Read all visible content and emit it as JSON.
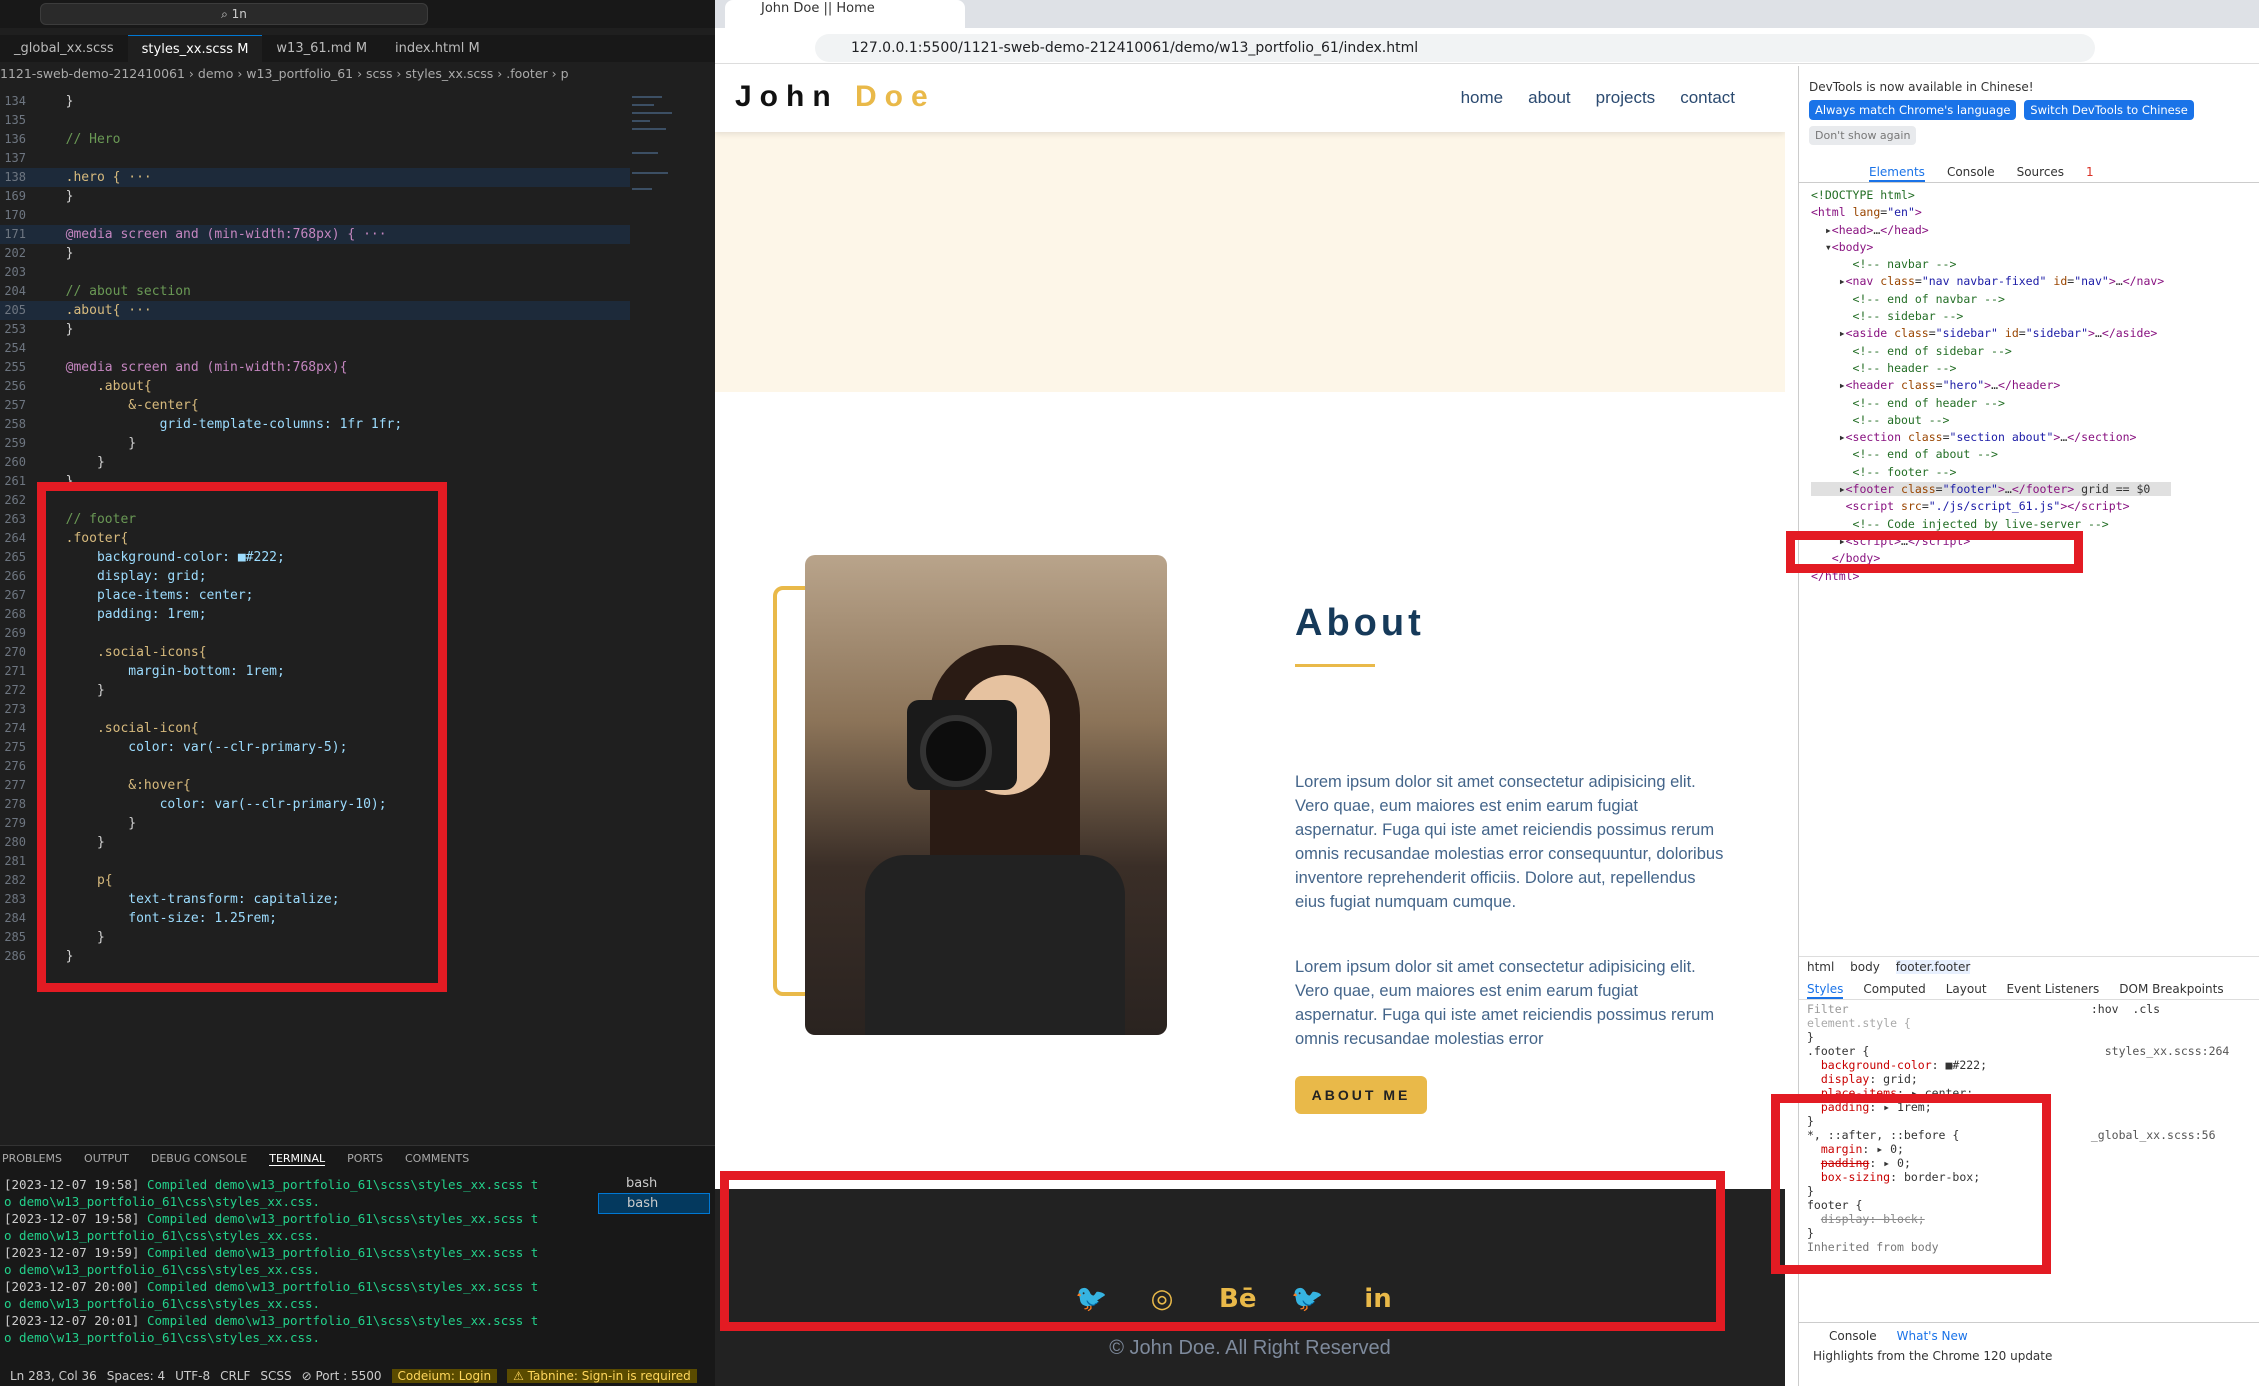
{
  "vscode": {
    "command_center": "⌕ 1n",
    "tabs": [
      "_global_xx.scss",
      "styles_xx.scss M",
      "w13_61.md M",
      "index.html M"
    ],
    "breadcrumb": "1121-sweb-demo-212410061 › demo › w13_portfolio_61 › scss › styles_xx.scss › .footer › p",
    "code_lines": [
      {
        "n": "134",
        "t": "  }",
        "c": "brace"
      },
      {
        "n": "135",
        "t": "",
        "c": "brace"
      },
      {
        "n": "136",
        "t": "  // Hero",
        "c": "com"
      },
      {
        "n": "137",
        "t": "",
        "c": "brace"
      },
      {
        "n": "138",
        "t": "  .hero { ···",
        "c": "sel",
        "hl": true
      },
      {
        "n": "169",
        "t": "  }",
        "c": "brace"
      },
      {
        "n": "170",
        "t": "",
        "c": "brace"
      },
      {
        "n": "171",
        "t": "  @media screen and (min-width:768px) { ···",
        "c": "key",
        "hl": true
      },
      {
        "n": "202",
        "t": "  }",
        "c": "brace"
      },
      {
        "n": "203",
        "t": "",
        "c": "brace"
      },
      {
        "n": "204",
        "t": "  // about section",
        "c": "com"
      },
      {
        "n": "205",
        "t": "  .about{ ···",
        "c": "sel",
        "hl": true
      },
      {
        "n": "253",
        "t": "  }",
        "c": "brace"
      },
      {
        "n": "254",
        "t": "",
        "c": "brace"
      },
      {
        "n": "255",
        "t": "  @media screen and (min-width:768px){",
        "c": "key"
      },
      {
        "n": "256",
        "t": "      .about{",
        "c": "sel"
      },
      {
        "n": "257",
        "t": "          &-center{",
        "c": "sel"
      },
      {
        "n": "258",
        "t": "              grid-template-columns: 1fr 1fr;",
        "c": "prop"
      },
      {
        "n": "259",
        "t": "          }",
        "c": "brace"
      },
      {
        "n": "260",
        "t": "      }",
        "c": "brace"
      },
      {
        "n": "261",
        "t": "  }",
        "c": "brace"
      },
      {
        "n": "262",
        "t": "",
        "c": "brace"
      },
      {
        "n": "263",
        "t": "  // footer",
        "c": "com"
      },
      {
        "n": "264",
        "t": "  .footer{",
        "c": "sel"
      },
      {
        "n": "265",
        "t": "      background-color: ■#222;",
        "c": "prop"
      },
      {
        "n": "266",
        "t": "      display: grid;",
        "c": "prop"
      },
      {
        "n": "267",
        "t": "      place-items: center;",
        "c": "prop"
      },
      {
        "n": "268",
        "t": "      padding: 1rem;",
        "c": "prop"
      },
      {
        "n": "269",
        "t": "",
        "c": "brace"
      },
      {
        "n": "270",
        "t": "      .social-icons{",
        "c": "sel"
      },
      {
        "n": "271",
        "t": "          margin-bottom: 1rem;",
        "c": "prop"
      },
      {
        "n": "272",
        "t": "      }",
        "c": "brace"
      },
      {
        "n": "273",
        "t": "",
        "c": "brace"
      },
      {
        "n": "274",
        "t": "      .social-icon{",
        "c": "sel"
      },
      {
        "n": "275",
        "t": "          color: var(--clr-primary-5);",
        "c": "prop"
      },
      {
        "n": "276",
        "t": "",
        "c": "brace"
      },
      {
        "n": "277",
        "t": "          &:hover{",
        "c": "sel"
      },
      {
        "n": "278",
        "t": "              color: var(--clr-primary-10);",
        "c": "prop"
      },
      {
        "n": "279",
        "t": "          }",
        "c": "brace"
      },
      {
        "n": "280",
        "t": "      }",
        "c": "brace"
      },
      {
        "n": "281",
        "t": "",
        "c": "brace"
      },
      {
        "n": "282",
        "t": "      p{",
        "c": "sel"
      },
      {
        "n": "283",
        "t": "          text-transform: capitalize;",
        "c": "prop"
      },
      {
        "n": "284",
        "t": "          font-size: 1.25rem;",
        "c": "prop"
      },
      {
        "n": "285",
        "t": "      }",
        "c": "brace"
      },
      {
        "n": "286",
        "t": "  }",
        "c": "brace"
      }
    ],
    "panel_tabs": [
      "PROBLEMS",
      "OUTPUT",
      "DEBUG CONSOLE",
      "TERMINAL",
      "PORTS",
      "COMMENTS"
    ],
    "terminal_lines": [
      {
        "ts": "[2023-12-07 19:58]",
        "msg": " Compiled demo\\w13_portfolio_61\\scss\\styles_xx.scss t"
      },
      {
        "ts": "",
        "msg": "o demo\\w13_portfolio_61\\css\\styles_xx.css."
      },
      {
        "ts": "[2023-12-07 19:58]",
        "msg": " Compiled demo\\w13_portfolio_61\\scss\\styles_xx.scss t"
      },
      {
        "ts": "",
        "msg": "o demo\\w13_portfolio_61\\css\\styles_xx.css."
      },
      {
        "ts": "[2023-12-07 19:59]",
        "msg": " Compiled demo\\w13_portfolio_61\\scss\\styles_xx.scss t"
      },
      {
        "ts": "",
        "msg": "o demo\\w13_portfolio_61\\css\\styles_xx.css."
      },
      {
        "ts": "[2023-12-07 20:00]",
        "msg": " Compiled demo\\w13_portfolio_61\\scss\\styles_xx.scss t"
      },
      {
        "ts": "",
        "msg": "o demo\\w13_portfolio_61\\css\\styles_xx.css."
      },
      {
        "ts": "[2023-12-07 20:01]",
        "msg": " Compiled demo\\w13_portfolio_61\\scss\\styles_xx.scss t"
      },
      {
        "ts": "",
        "msg": "o demo\\w13_portfolio_61\\css\\styles_xx.css."
      }
    ],
    "terminals": [
      "bash",
      "bash"
    ],
    "status": {
      "position": "Ln 283, Col 36",
      "spaces": "Spaces: 4",
      "encoding": "UTF-8",
      "eol": "CRLF",
      "language": "SCSS",
      "port": "⊘ Port : 5500",
      "codeium": "Codeium: Login",
      "tabnine": "⚠ Tabnine: Sign-in is required"
    }
  },
  "browser": {
    "tab_title": "John Doe || Home",
    "url": "127.0.0.1:5500/1121-sweb-demo-212410061/demo/w13_portfolio_61/index.html",
    "site": {
      "logo_first": "John",
      "logo_last": "Doe",
      "nav_links": [
        "home",
        "about",
        "projects",
        "contact"
      ],
      "about_title": "About",
      "about_p1": "Lorem ipsum dolor sit amet consectetur adipisicing elit. Vero quae, eum maiores est enim earum fugiat aspernatur. Fuga qui iste amet reiciendis possimus rerum omnis recusandae molestias error consequuntur, doloribus inventore reprehenderit officiis. Dolore aut, repellendus eius fugiat numquam cumque.",
      "about_p2": "Lorem ipsum dolor sit amet consectetur adipisicing elit. Vero quae, eum maiores est enim earum fugiat aspernatur. Fuga qui iste amet reiciendis possimus rerum omnis recusandae molestias error",
      "about_btn": "ABOUT ME",
      "footer_icons": [
        "twitter-icon",
        "instagram-icon",
        "behance-icon",
        "twitter-icon",
        "linkedin-icon"
      ],
      "footer_copy": "© John Doe. All Right Reserved",
      "accent": "#e9b949"
    }
  },
  "devtools": {
    "banner_text": "DevTools is now available in Chinese!",
    "btn_match": "Always match Chrome's language",
    "btn_switch": "Switch DevTools to Chinese",
    "btn_dont": "Don't show again",
    "tabs": [
      "Elements",
      "Console",
      "Sources"
    ],
    "error_count": "1",
    "crumbs": [
      "html",
      "body",
      "footer.footer"
    ],
    "style_tabs": [
      "Styles",
      "Computed",
      "Layout",
      "Event Listeners",
      "DOM Breakpoints"
    ],
    "filter_placeholder": "Filter",
    "hov_cls": ":hov  .cls",
    "styles_footer_src": "styles_xx.scss:264",
    "styles_global_src": "_global_xx.scss:56",
    "inherited": "Inherited from body",
    "bottom_tabs": [
      "Console",
      "What's New"
    ],
    "whatsnew": "Highlights from the Chrome 120 update"
  }
}
